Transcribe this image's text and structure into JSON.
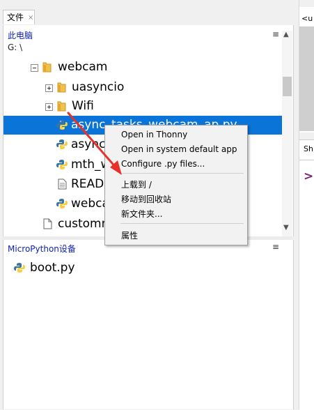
{
  "files_tab": {
    "label": "文件",
    "close": "×"
  },
  "files_panel": {
    "title": "此电脑",
    "path": "G: \\",
    "menu": "≡",
    "items": [
      {
        "label": "webcam"
      },
      {
        "label": "uasyncio"
      },
      {
        "label": "Wifi"
      },
      {
        "label": "async_tasks_webcam_ap.py"
      },
      {
        "label": "async_"
      },
      {
        "label": "mth_w"
      },
      {
        "label": "READI"
      },
      {
        "label": "webca"
      },
      {
        "label": "customn"
      }
    ]
  },
  "device_panel": {
    "title": "MicroPython设备",
    "menu": "≡",
    "items": [
      {
        "label": "boot.py"
      }
    ]
  },
  "right_panes": {
    "editor_tab": "<u",
    "shell_tab": "Sh",
    "prompt": ">",
    "menu": "≡"
  },
  "context_menu": {
    "items": [
      "Open in Thonny",
      "Open in system default app",
      "Configure .py files...",
      "上载到 /",
      "移动到回收站",
      "新文件夹...",
      "属性"
    ]
  },
  "colors": {
    "selection": "#0a74d8",
    "panel_title": "#0a1fb0",
    "annotation_arrow": "#e8312a"
  }
}
